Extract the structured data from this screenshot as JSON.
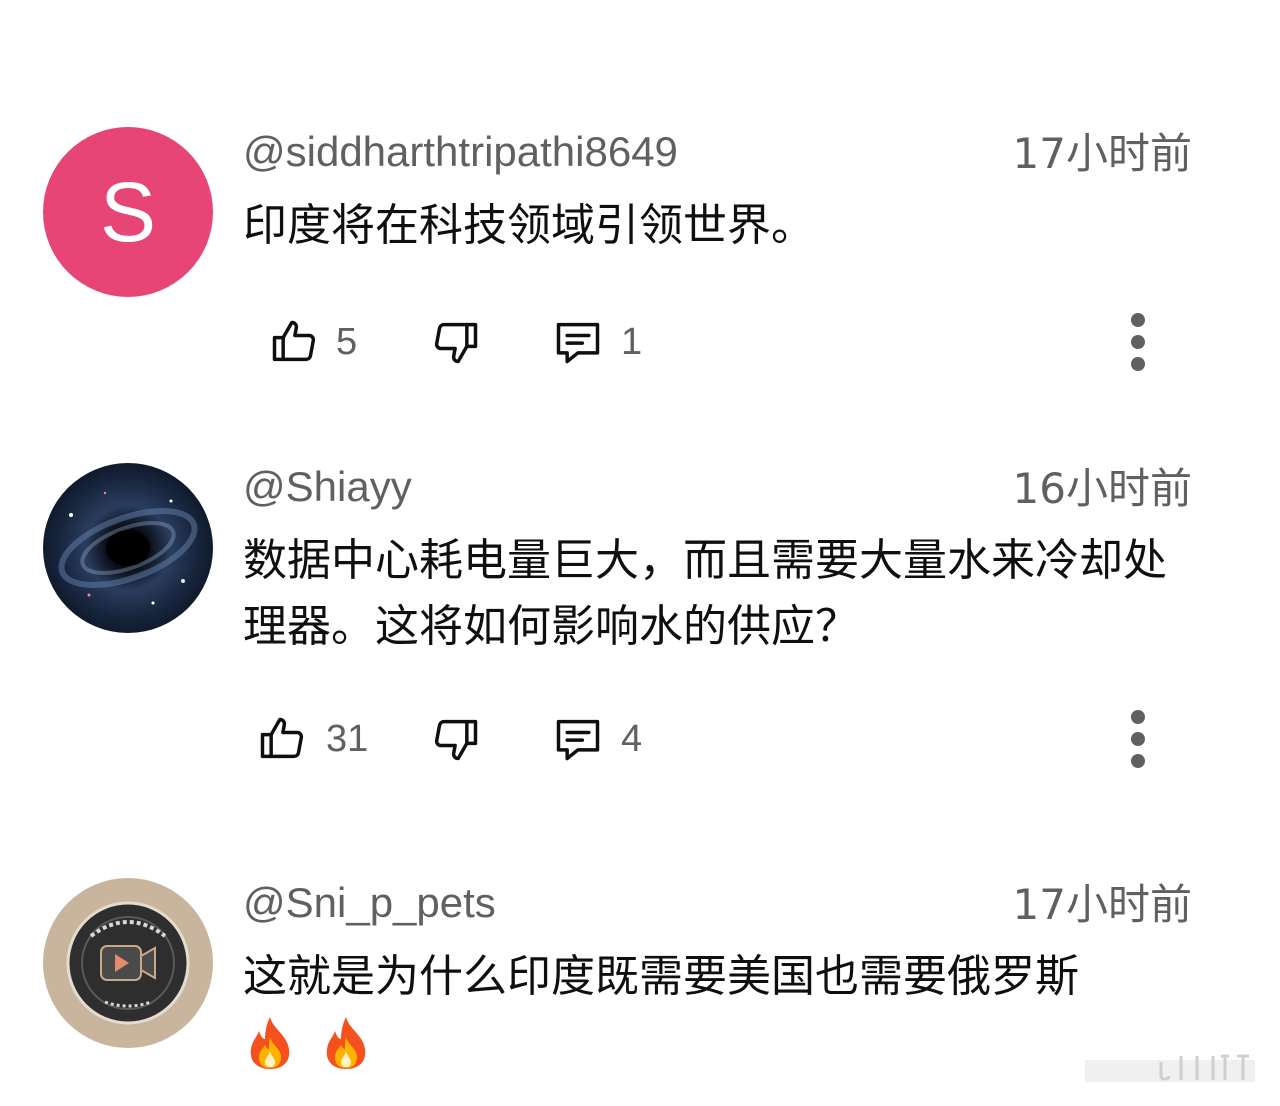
{
  "comments": [
    {
      "avatar_letter": "S",
      "avatar_color": "#e84577",
      "handle": "@siddharthtripathi8649",
      "time": "17小时前",
      "text": "印度将在科技领域引领世界。",
      "likes": "5",
      "replies": "1"
    },
    {
      "avatar_icon": "galaxy-avatar",
      "handle": "@Shiayy",
      "time": "16小时前",
      "text": "数据中心耗电量巨大，而且需要大量水来冷却处理器。这将如何影响水的供应？",
      "likes": "31",
      "replies": "4"
    },
    {
      "avatar_icon": "camera-logo-avatar",
      "handle": "@Sni_p_pets",
      "time": "17小时前",
      "text": "这就是为什么印度既需要美国也需要俄罗斯",
      "emoji": [
        "fire-icon",
        "fire-icon"
      ]
    }
  ],
  "icons": {
    "like": "thumbs-up-icon",
    "dislike": "thumbs-down-icon",
    "reply": "comment-icon",
    "more": "more-vert-icon"
  },
  "colors": {
    "text_primary": "#0f0f0f",
    "text_secondary": "#606060",
    "icon": "#0f0f0f"
  }
}
